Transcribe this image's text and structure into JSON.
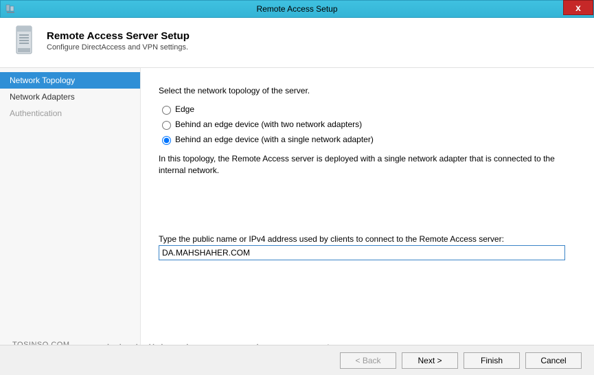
{
  "window": {
    "title": "Remote Access Setup",
    "close_label": "x"
  },
  "header": {
    "title": "Remote Access Server Setup",
    "subtitle": "Configure DirectAccess and VPN settings."
  },
  "sidebar": {
    "items": [
      {
        "label": "Network Topology",
        "state": "selected"
      },
      {
        "label": "Network Adapters",
        "state": "normal"
      },
      {
        "label": "Authentication",
        "state": "disabled"
      }
    ]
  },
  "content": {
    "instruction": "Select the network topology of the server.",
    "radios": [
      {
        "label": "Edge",
        "checked": false
      },
      {
        "label": "Behind an edge device (with two network adapters)",
        "checked": false
      },
      {
        "label": "Behind an edge device (with a single network adapter)",
        "checked": true
      }
    ],
    "description": "In this topology, the Remote Access server is deployed with a single network adapter that is connected to the internal network.",
    "public_name_label": "Type the public name or IPv4 address used by clients to connect to the Remote Access server:",
    "public_name_value": "DA.MAHSHAHER.COM"
  },
  "footer": {
    "back": "< Back",
    "next": "Next >",
    "finish": "Finish",
    "cancel": "Cancel"
  },
  "watermark": {
    "left": "TOSINSO.COM",
    "right": "ITPro.ir - وب سایت تخصصی فناوری اطلاعات ایران"
  }
}
